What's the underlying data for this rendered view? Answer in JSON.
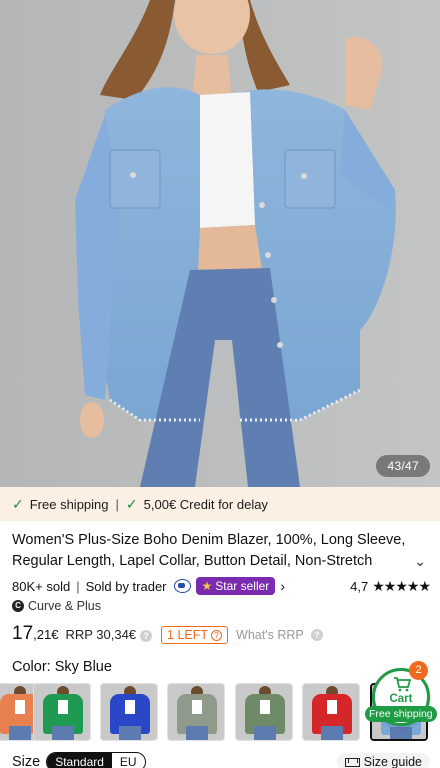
{
  "product_image": {
    "alt": "Woman wearing sky blue distressed denim shirt jacket over white crop top and blue jeans",
    "counter": "43/47"
  },
  "shipping_bar": {
    "free_shipping": "Free shipping",
    "credit": "5,00€ Credit for delay"
  },
  "product": {
    "title": "Women'S Plus-Size Boho Denim Blazer, 100%, Long Sleeve, Regular Length, Lapel Collar, Button Detail, Non-Stretch",
    "sold": "80K+ sold",
    "sold_by": "Sold by trader",
    "star_seller": "Star seller",
    "rating": "4,7",
    "stars": "★★★★★",
    "brand_icon": "C",
    "brand": "Curve & Plus",
    "price_main": "17",
    "price_cents": ",21€",
    "rrp": "RRP 30,34€",
    "left_badge": "1 LEFT",
    "whats_rrp": "What's RRP"
  },
  "color": {
    "label": "Color: Sky Blue",
    "swatches": [
      {
        "name": "Orange",
        "hex": "#e8804f"
      },
      {
        "name": "Green",
        "hex": "#1f9a52"
      },
      {
        "name": "Royal Blue",
        "hex": "#2a47c8"
      },
      {
        "name": "Grey Green",
        "hex": "#8f9a8a"
      },
      {
        "name": "Olive",
        "hex": "#6f8a66"
      },
      {
        "name": "Red",
        "hex": "#d5262a"
      },
      {
        "name": "Sky Blue",
        "hex": "#7aa9d8"
      }
    ]
  },
  "cart": {
    "label": "Cart",
    "count": "2",
    "free_shipping": "Free shipping"
  },
  "size": {
    "label": "Size",
    "standard": "Standard",
    "eu": "EU",
    "guide": "Size guide"
  },
  "colors": {
    "accent_green": "#1f9b45",
    "accent_orange": "#f06a1d",
    "star_seller_purple": "#7b2bb0",
    "shipping_bar_bg": "#fcf0e4"
  }
}
